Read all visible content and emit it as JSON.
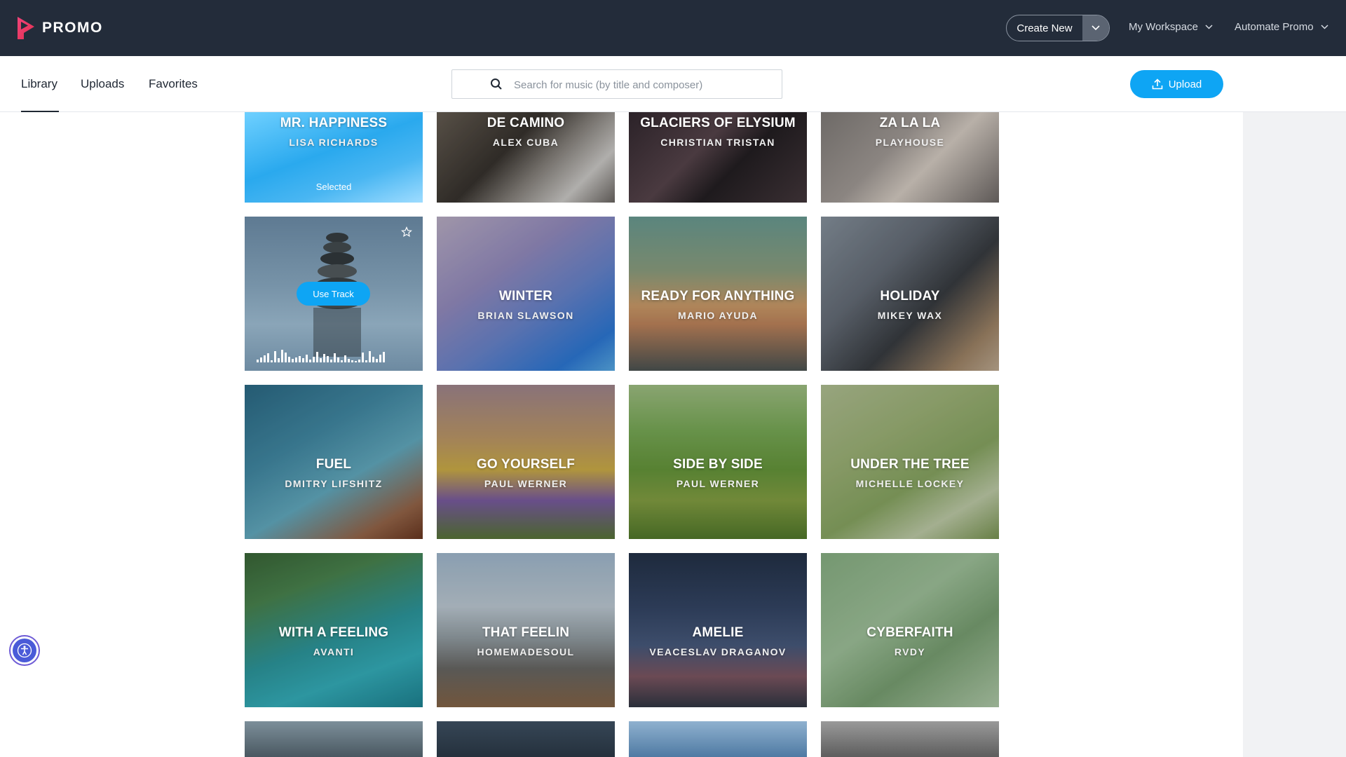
{
  "brand": {
    "name": "PROMO"
  },
  "topbar": {
    "create_new": "Create New",
    "my_workspace": "My Workspace",
    "automate_promo": "Automate Promo"
  },
  "tabs": [
    {
      "label": "Library",
      "active": true
    },
    {
      "label": "Uploads",
      "active": false
    },
    {
      "label": "Favorites",
      "active": false
    }
  ],
  "search": {
    "placeholder": "Search for music (by title and composer)",
    "value": ""
  },
  "upload_label": "Upload",
  "tracks": [
    {
      "title": "Mr. Happiness",
      "composer": "Lisa Richards",
      "status": "Selected"
    },
    {
      "title": "De Camino",
      "composer": "Alex Cuba"
    },
    {
      "title": "Glaciers of Elysium",
      "composer": "Christian Tristan"
    },
    {
      "title": "Za La La",
      "composer": "Playhouse"
    },
    {
      "title": "",
      "composer": "",
      "action": "Use Track",
      "hovered": true
    },
    {
      "title": "Winter",
      "composer": "Brian Slawson"
    },
    {
      "title": "Ready for Anything",
      "composer": "Mario Ayuda"
    },
    {
      "title": "Holiday",
      "composer": "Mikey Wax"
    },
    {
      "title": "Fuel",
      "composer": "Dmitry Lifshitz"
    },
    {
      "title": "Go Yourself",
      "composer": "Paul Werner"
    },
    {
      "title": "Side by Side",
      "composer": "Paul Werner"
    },
    {
      "title": "Under the Tree",
      "composer": "Michelle Lockey"
    },
    {
      "title": "With a Feeling",
      "composer": "Avanti"
    },
    {
      "title": "That Feelin",
      "composer": "Homemadesoul"
    },
    {
      "title": "Amelie",
      "composer": "Veaceslav Draganov"
    },
    {
      "title": "Cyberfaith",
      "composer": "RVDY"
    }
  ],
  "icons": {
    "logo": "promo-play-logo",
    "search": "search-icon",
    "upload": "upload-icon",
    "star": "star-icon",
    "dropdown": "chevron-down-icon",
    "accessibility": "accessibility-icon"
  },
  "colors": {
    "topbar_bg": "#232c3a",
    "accent_blue": "#0ea5f4",
    "logo_pink": "#ee3a6a",
    "side_column": "#f1f2f4"
  }
}
